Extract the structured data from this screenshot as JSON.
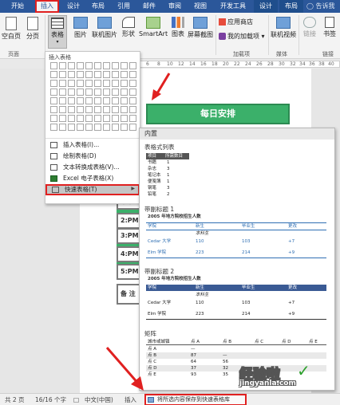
{
  "tabs": [
    "开始",
    "插入",
    "设计",
    "布局",
    "引用",
    "邮件",
    "审阅",
    "视图",
    "开发工具",
    "设计",
    "布局"
  ],
  "tell_me": "告诉我",
  "ribbon": {
    "buttons": {
      "blank_page": "空白页",
      "page_break": "分页",
      "table": "表格",
      "picture": "图片",
      "online_picture": "联机图片",
      "shapes": "形状",
      "smartart": "SmartArt",
      "chart": "图表",
      "screenshot": "屏幕截图",
      "app_store": "应用商店",
      "my_addins": "我的加载项",
      "online_video": "联机视频",
      "link": "链接",
      "bookmark": "书签"
    },
    "groups": {
      "pages": "页面",
      "addins": "加载项",
      "media": "媒体",
      "links": "链接"
    }
  },
  "ruler_numbers": [
    "6",
    "8",
    "10",
    "12",
    "14",
    "16",
    "18",
    "20",
    "22",
    "24",
    "26",
    "28",
    "30",
    "32",
    "34",
    "36",
    "38",
    "40",
    "42"
  ],
  "table_dropdown": {
    "title": "插入表格",
    "menu": [
      {
        "label": "插入表格(I)...",
        "selected": false
      },
      {
        "label": "绘制表格(D)",
        "selected": false
      },
      {
        "label": "文本转换成表格(V)...",
        "selected": false
      },
      {
        "label": "Excel 电子表格(X)",
        "selected": false
      },
      {
        "label": "快速表格(T)",
        "selected": true
      }
    ]
  },
  "schedule": {
    "header": "每日安排",
    "rows": [
      "中午",
      "2:PM",
      "3:PM",
      "4:PM",
      "5:PM"
    ],
    "bottom": "备 注"
  },
  "gallery": {
    "header": "内置",
    "sections": {
      "tabular": "表格式列表",
      "subheads1": "带副标题 1",
      "subheads2": "带副标题 2",
      "matrix": "矩阵"
    },
    "tabular_list": {
      "columns": [
        "项目",
        "所需数目"
      ],
      "rows": [
        [
          "书籍",
          "1"
        ],
        [
          "杂志",
          "3"
        ],
        [
          "笔记本",
          "1"
        ],
        [
          "便笺簿",
          "1"
        ],
        [
          "钢笔",
          "3"
        ],
        [
          "铅笔",
          "2"
        ]
      ]
    },
    "subheads1": {
      "title": "2005 年地方院校招生人数",
      "columns": [
        "学院",
        "新生",
        "毕业生",
        "更改"
      ],
      "subrow": "本科生",
      "rows": [
        [
          "Cedar 大学",
          "110",
          "103",
          "+7"
        ],
        [
          "Elm 学院",
          "223",
          "214",
          "+9"
        ]
      ]
    },
    "subheads2": {
      "title": "2005 年地方院校招生人数",
      "columns": [
        "学院",
        "新生",
        "毕业生",
        "更改"
      ],
      "subrow": "本科生",
      "rows": [
        [
          "Cedar 大学",
          "110",
          "103",
          "+7"
        ],
        [
          "Elm 学院",
          "223",
          "214",
          "+9"
        ]
      ]
    },
    "matrix": {
      "columns": [
        "城市或城镇",
        "点 A",
        "点 B",
        "点 C",
        "点 D",
        "点 E"
      ],
      "rows": [
        [
          "点 A",
          "—",
          "",
          "",
          "",
          ""
        ],
        [
          "点 B",
          "87",
          "—",
          "",
          "",
          ""
        ],
        [
          "点 C",
          "64",
          "56",
          "",
          "",
          ""
        ],
        [
          "点 D",
          "37",
          "32",
          "",
          "",
          ""
        ],
        [
          "点 E",
          "93",
          "35",
          "",
          "",
          ""
        ]
      ]
    }
  },
  "status": {
    "pages": "共 2 页",
    "words": "16/16 个字",
    "lang": "中文(中国)",
    "mode": "插入",
    "tip": "将所选内容保存到快速表格库"
  },
  "watermark": {
    "text": "经验啦",
    "sub": "jingyanla.com"
  },
  "colors": {
    "title_bar": "#2b579a",
    "highlight": "#e02020",
    "schedule_green": "#3bb06a"
  }
}
